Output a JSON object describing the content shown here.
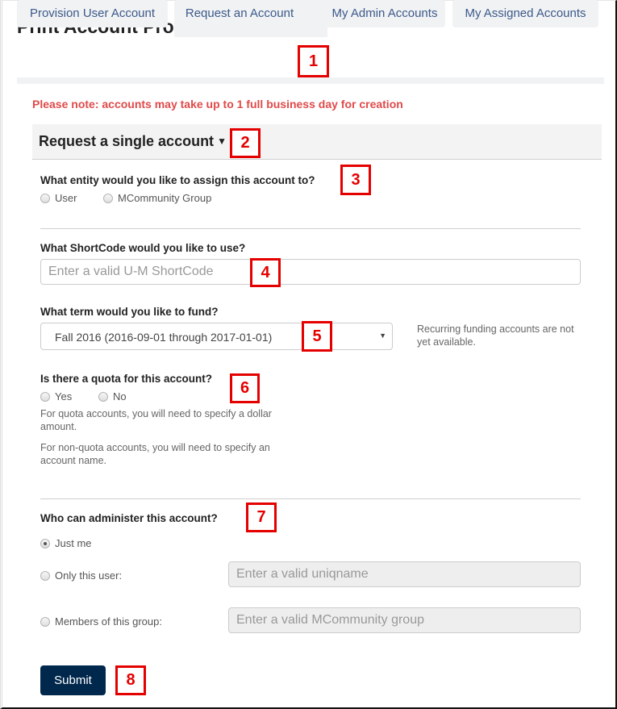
{
  "page": {
    "title": "Print Account Provisioning"
  },
  "tabs": [
    {
      "label": "Provision User Account",
      "active": false
    },
    {
      "label": "Request an Account",
      "active": true
    },
    {
      "label": "My Admin Accounts",
      "active": false
    },
    {
      "label": "My Assigned Accounts",
      "active": false
    }
  ],
  "notice": "Please note: accounts may take up to 1 full business day for creation",
  "section": {
    "title": "Request a single account",
    "caret_icon": "caret-down-icon",
    "caret_glyph": "▼"
  },
  "entity": {
    "label": "What entity would you like to assign this account to?",
    "options": [
      {
        "label": "User",
        "checked": false
      },
      {
        "label": "MCommunity Group",
        "checked": false
      }
    ]
  },
  "shortcode": {
    "label": "What ShortCode would you like to use?",
    "value": "",
    "placeholder": "Enter a valid U-M ShortCode"
  },
  "term": {
    "label": "What term would you like to fund?",
    "selected": "Fall 2016 (2016-09-01 through 2017-01-01)",
    "arrow_glyph": "▼",
    "help": "Recurring funding accounts are not yet available."
  },
  "quota": {
    "label": "Is there a quota for this account?",
    "options": [
      {
        "label": "Yes",
        "checked": false
      },
      {
        "label": "No",
        "checked": false
      }
    ],
    "help_quota": "For quota accounts, you will need to specify a dollar amount.",
    "help_nonquota": "For non-quota accounts, you will need to specify an account name."
  },
  "admin": {
    "label": "Who can administer this account?",
    "options": [
      {
        "label": "Just me",
        "checked": true
      },
      {
        "label": "Only this user:",
        "checked": false,
        "input_placeholder": "Enter a valid uniqname",
        "input_value": ""
      },
      {
        "label": "Members of this group:",
        "checked": false,
        "input_placeholder": "Enter a valid MCommunity group",
        "input_value": ""
      }
    ]
  },
  "submit_label": "Submit",
  "annotations": [
    "1",
    "2",
    "3",
    "4",
    "5",
    "6",
    "7",
    "8"
  ],
  "colors": {
    "notice": "#e04a4a",
    "tab_text": "#3c5a8a",
    "submit_bg": "#00274c",
    "annotation": "#e50000"
  }
}
